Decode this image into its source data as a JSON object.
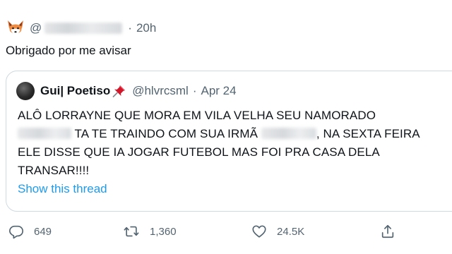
{
  "tweet": {
    "author_emoji_icon": "fox-face-emoji",
    "handle_prefix": "@",
    "time_sep": "·",
    "time": "20h",
    "text": "Obrigado por me avisar"
  },
  "quoted": {
    "name": "Gui| Poetiso",
    "pin_icon": "pushpin-emoji",
    "handle": "@hlvrcsml",
    "date_sep": "·",
    "date": "Apr 24",
    "line1": "ALÔ LORRAYNE QUE MORA EM VILA VELHA SEU NAMORADO",
    "line2_a": "TA TE TRAINDO COM SUA IRMÃ",
    "line2_b": ", NA SEXTA FEIRA",
    "line3": "ELE DISSE QUE IA JOGAR FUTEBOL MAS FOI PRA CASA DELA",
    "line4": "TRANSAR!!!!",
    "show_thread": "Show this thread"
  },
  "actions": {
    "reply_count": "649",
    "retweet_count": "1,360",
    "like_count": "24.5K",
    "icons": [
      "reply-icon",
      "retweet-icon",
      "like-icon",
      "share-icon"
    ]
  },
  "colors": {
    "text": "#0f1419",
    "secondary": "#536471",
    "link": "#1d9bf0",
    "border": "#cfd9de"
  }
}
